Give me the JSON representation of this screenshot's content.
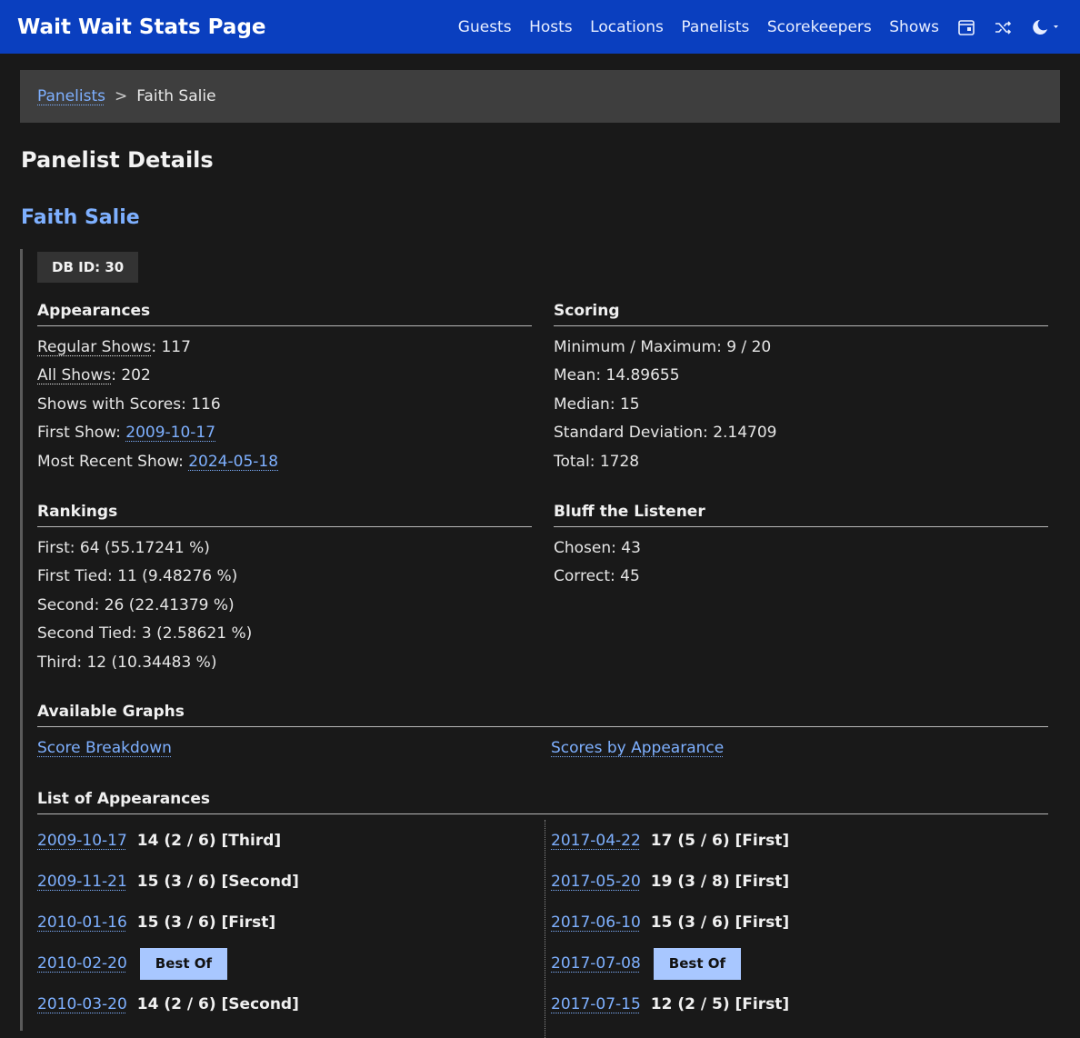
{
  "navbar": {
    "brand": "Wait Wait Stats Page",
    "links": [
      "Guests",
      "Hosts",
      "Locations",
      "Panelists",
      "Scorekeepers",
      "Shows"
    ],
    "icons": [
      "calendar-icon",
      "shuffle-icon",
      "theme-moon-icon"
    ]
  },
  "breadcrumb": {
    "parent": "Panelists",
    "separator": ">",
    "current": "Faith Salie"
  },
  "page": {
    "title": "Panelist Details",
    "panelist_name": "Faith Salie",
    "db_id": "DB ID: 30"
  },
  "appearances": {
    "heading": "Appearances",
    "regular_label": "Regular Shows",
    "regular_value": ": 117",
    "all_label": "All Shows",
    "all_value": ": 202",
    "with_scores": "Shows with Scores: 116",
    "first_show_label": "First Show: ",
    "first_show": "2009-10-17",
    "recent_show_label": "Most Recent Show: ",
    "recent_show": "2024-05-18"
  },
  "scoring": {
    "heading": "Scoring",
    "min_max": "Minimum / Maximum: 9 / 20",
    "mean": "Mean: 14.89655",
    "median": "Median: 15",
    "stddev": "Standard Deviation: 2.14709",
    "total": "Total: 1728"
  },
  "rankings": {
    "heading": "Rankings",
    "first": "First: 64 (55.17241 %)",
    "first_tied": "First Tied: 11 (9.48276 %)",
    "second": "Second: 26 (22.41379 %)",
    "second_tied": "Second Tied: 3 (2.58621 %)",
    "third": "Third: 12 (10.34483 %)"
  },
  "bluff": {
    "heading": "Bluff the Listener",
    "chosen": "Chosen: 43",
    "correct": "Correct: 45"
  },
  "graphs": {
    "heading": "Available Graphs",
    "score_breakdown": "Score Breakdown",
    "scores_by_appearance": "Scores by Appearance"
  },
  "list": {
    "heading": "List of Appearances",
    "left": [
      {
        "date": "2009-10-17",
        "score": "14 (2 / 6) [Third]",
        "best_of": ""
      },
      {
        "date": "2009-11-21",
        "score": "15 (3 / 6) [Second]",
        "best_of": ""
      },
      {
        "date": "2010-01-16",
        "score": "15 (3 / 6) [First]",
        "best_of": ""
      },
      {
        "date": "2010-02-20",
        "score": "",
        "best_of": "Best Of"
      },
      {
        "date": "2010-03-20",
        "score": "14 (2 / 6) [Second]",
        "best_of": ""
      }
    ],
    "right": [
      {
        "date": "2017-04-22",
        "score": "17 (5 / 6) [First]",
        "best_of": ""
      },
      {
        "date": "2017-05-20",
        "score": "19 (3 / 8) [First]",
        "best_of": ""
      },
      {
        "date": "2017-06-10",
        "score": "15 (3 / 6) [First]",
        "best_of": ""
      },
      {
        "date": "2017-07-08",
        "score": "",
        "best_of": "Best Of"
      },
      {
        "date": "2017-07-15",
        "score": "12 (2 / 5) [First]",
        "best_of": ""
      }
    ]
  }
}
